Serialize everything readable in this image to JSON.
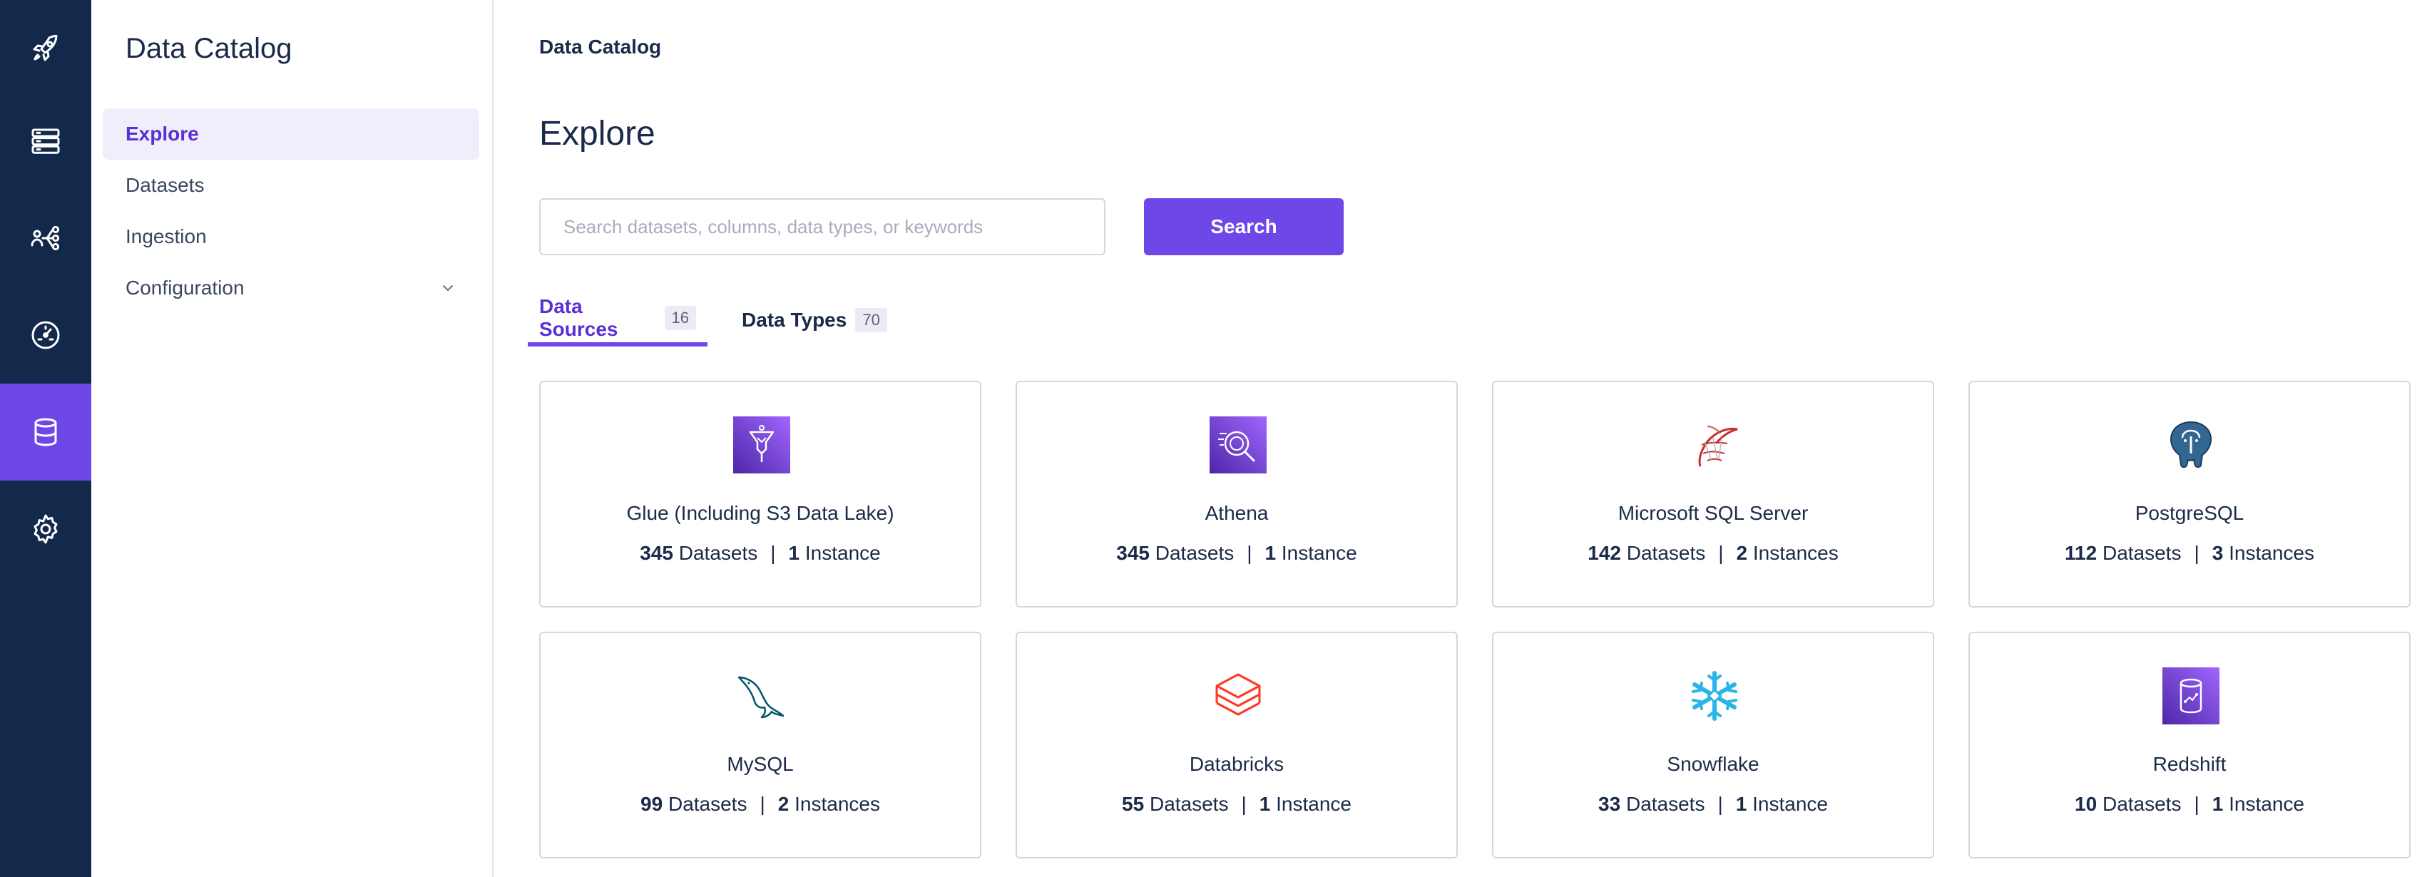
{
  "rail": {
    "items": [
      {
        "icon": "rocket-icon"
      },
      {
        "icon": "server-icon"
      },
      {
        "icon": "lineage-icon"
      },
      {
        "icon": "gauge-icon"
      },
      {
        "icon": "database-icon",
        "active": true
      },
      {
        "icon": "gear-icon"
      }
    ],
    "background": "#13294b",
    "active_color": "#6e47e8"
  },
  "sidebar": {
    "title": "Data Catalog",
    "items": [
      {
        "label": "Explore",
        "active": true
      },
      {
        "label": "Datasets"
      },
      {
        "label": "Ingestion"
      },
      {
        "label": "Configuration",
        "expandable": true
      }
    ]
  },
  "main": {
    "breadcrumb": "Data Catalog",
    "title": "Explore",
    "search": {
      "placeholder": "Search datasets, columns, data types, or keywords",
      "value": "",
      "button_label": "Search"
    },
    "tabs": [
      {
        "label": "Data Sources",
        "count": "16",
        "active": true
      },
      {
        "label": "Data Types",
        "count": "70"
      }
    ],
    "sources": [
      {
        "name": "Glue (Including S3 Data Lake)",
        "datasets": "345",
        "datasets_label": "Datasets",
        "instances": "1",
        "instances_label": "Instance",
        "icon": "aws-glue-icon"
      },
      {
        "name": "Athena",
        "datasets": "345",
        "datasets_label": "Datasets",
        "instances": "1",
        "instances_label": "Instance",
        "icon": "aws-athena-icon"
      },
      {
        "name": "Microsoft SQL Server",
        "datasets": "142",
        "datasets_label": "Datasets",
        "instances": "2",
        "instances_label": "Instances",
        "icon": "sql-server-icon"
      },
      {
        "name": "PostgreSQL",
        "datasets": "112",
        "datasets_label": "Datasets",
        "instances": "3",
        "instances_label": "Instances",
        "icon": "postgresql-icon"
      },
      {
        "name": "MySQL",
        "datasets": "99",
        "datasets_label": "Datasets",
        "instances": "2",
        "instances_label": "Instances",
        "icon": "mysql-icon"
      },
      {
        "name": "Databricks",
        "datasets": "55",
        "datasets_label": "Datasets",
        "instances": "1",
        "instances_label": "Instance",
        "icon": "databricks-icon"
      },
      {
        "name": "Snowflake",
        "datasets": "33",
        "datasets_label": "Datasets",
        "instances": "1",
        "instances_label": "Instance",
        "icon": "snowflake-icon"
      },
      {
        "name": "Redshift",
        "datasets": "10",
        "datasets_label": "Datasets",
        "instances": "1",
        "instances_label": "Instance",
        "icon": "aws-redshift-icon"
      }
    ],
    "separator": "|"
  },
  "colors": {
    "accent": "#6e47e8",
    "accent_text": "#5b2fd6",
    "text": "#1b2a48",
    "border": "#d3d7e0"
  }
}
